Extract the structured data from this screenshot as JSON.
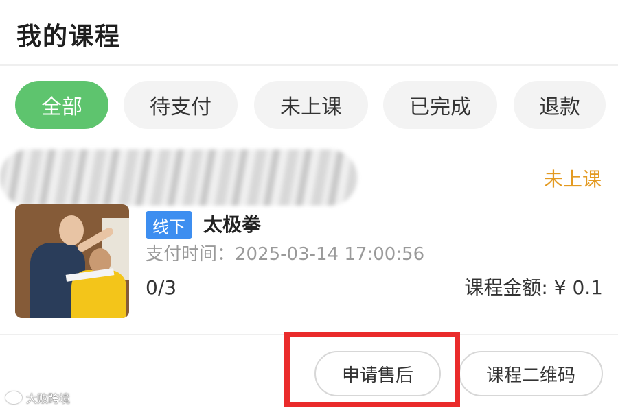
{
  "header": {
    "title": "我的课程"
  },
  "tabs": [
    {
      "label": "全部",
      "active": true
    },
    {
      "label": "待支付",
      "active": false
    },
    {
      "label": "未上课",
      "active": false
    },
    {
      "label": "已完成",
      "active": false
    },
    {
      "label": "退款",
      "active": false
    }
  ],
  "order": {
    "status": "未上课",
    "course": {
      "tag": "线下",
      "name": "太极拳",
      "pay_time": "支付时间：2025-03-14 17:00:56",
      "progress": "0/3",
      "amount": "课程金额: ¥ 0.1"
    },
    "actions": {
      "after_sale": "申请售后",
      "qr_code": "课程二维码"
    }
  },
  "watermark": {
    "text": "大败跨境"
  },
  "colors": {
    "accent_green": "#5ec46e",
    "status_orange": "#e39a22",
    "tag_blue": "#3d8ef0",
    "highlight_red": "#ea2b2b"
  }
}
